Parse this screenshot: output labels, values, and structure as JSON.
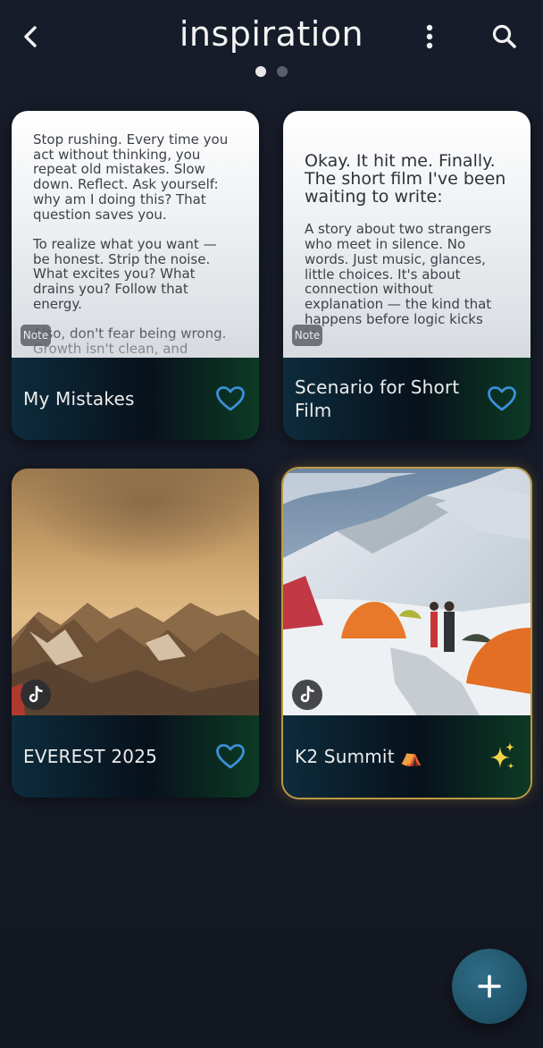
{
  "header": {
    "title": "inspiration",
    "back_icon": "chevron-left-icon",
    "more_icon": "more-vertical-icon",
    "search_icon": "search-icon",
    "pages": 2,
    "active_page": 1
  },
  "cards": [
    {
      "type": "note",
      "badge": "Note",
      "label": "My Mistakes",
      "action_icon": "heart-outline-icon",
      "heading": "",
      "body": "Stop rushing. Every time you\nact without thinking, you\nrepeat old mistakes. Slow\ndown. Reflect. Ask yourself:\nwhy am I doing this? That\nquestion saves you.\n\nTo realize what you want —\nbe honest. Strip the noise.\nWhat excites you? What\ndrains you? Follow that\nenergy.\n\nAlso, don't fear being wrong.\nGrowth isn't clean, and"
    },
    {
      "type": "note",
      "badge": "Note",
      "label": "Scenario for Short Film",
      "action_icon": "heart-outline-icon",
      "heading": "Okay. It hit me. Finally.\nThe short film I've been\nwaiting to write:",
      "body": "A story about two strangers\nwho meet in silence. No\nwords. Just music, glances,\nlittle choices. It's about\nconnection without\nexplanation — the kind that\nhappens before logic kicks\nin.\n\nMy favorite theme, obviously:\nintimacy in quiet moments."
    },
    {
      "type": "tiktok",
      "badge_icon": "tiktok-icon",
      "label": "EVEREST 2025",
      "action_icon": "heart-outline-icon",
      "image": "golden-mountain-range-photo"
    },
    {
      "type": "tiktok",
      "badge_icon": "tiktok-icon",
      "label": "K2 Summit ⛺",
      "action_icon": "sparkles-icon",
      "image": "snowy-camp-tents-photo"
    }
  ],
  "fab": {
    "icon": "plus-icon"
  },
  "colors": {
    "background": "#161b28",
    "accent_heart": "#3a8fd8",
    "sparkle": "#f2d44a",
    "fab": "#23596f",
    "highlight_border": "#d6ac46"
  }
}
